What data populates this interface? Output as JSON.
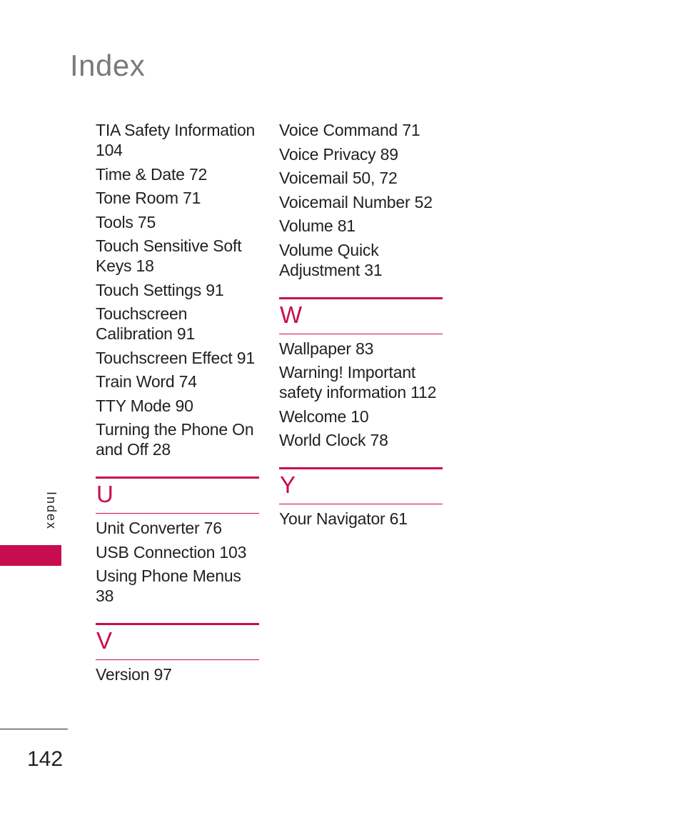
{
  "page": {
    "title": "Index",
    "side_tab_label": "Index",
    "page_number": "142",
    "accent_color": "#c80d4f"
  },
  "left_column": {
    "t_entries": [
      "TIA Safety Information 104",
      "Time & Date 72",
      "Tone Room 71",
      "Tools 75",
      "Touch Sensitive Soft Keys 18",
      "Touch Settings 91",
      "Touchscreen Calibration 91",
      "Touchscreen Effect 91",
      "Train Word 74",
      "TTY Mode 90",
      "Turning the Phone On and Off 28"
    ],
    "sections": [
      {
        "letter": "U",
        "entries": [
          "Unit Converter 76",
          "USB Connection 103",
          "Using Phone Menus 38"
        ]
      },
      {
        "letter": "V",
        "entries": [
          "Version 97"
        ]
      }
    ]
  },
  "right_column": {
    "v_entries": [
      "Voice Command 71",
      "Voice Privacy 89",
      "Voicemail 50, 72",
      "Voicemail Number 52",
      "Volume 81",
      "Volume Quick Adjustment 31"
    ],
    "sections": [
      {
        "letter": "W",
        "entries": [
          "Wallpaper 83",
          "Warning! Important safety information 112",
          "Welcome 10",
          "World Clock 78"
        ]
      },
      {
        "letter": "Y",
        "entries": [
          "Your Navigator 61"
        ]
      }
    ]
  }
}
